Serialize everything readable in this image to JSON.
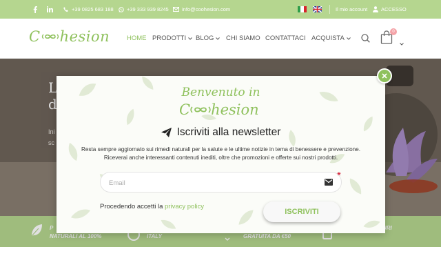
{
  "topbar": {
    "phone": "+39 0825 683 188",
    "whatsapp": "+39 333 939 8245",
    "email": "info@coohesion.com",
    "account": "Il mio account",
    "login": "ACCESSO"
  },
  "logo_text": {
    "start": "C",
    "end": "hesion"
  },
  "nav": {
    "home": "HOME",
    "products": "PRODOTTI",
    "blog": "BLOG",
    "about": "CHI SIAMO",
    "contacts": "CONTATTACI",
    "buy": "ACQUISTA",
    "cart_count": "0"
  },
  "hero": {
    "title_line1": "L",
    "title_line2": "d",
    "sub_line1": "Ini",
    "sub_line2": "sc"
  },
  "features": {
    "f1_line1": "P",
    "f1_line2": "NATURALI AL 100%",
    "f2_line2": "ITALY",
    "f3_line2": "GRATUITA DA €50",
    "f4_line1": "URI"
  },
  "modal": {
    "welcome": "Benvenuto in",
    "logo_start": "C",
    "logo_end": "hesion",
    "newsletter_title": "Iscriviti alla newsletter",
    "desc_line1": "Resta sempre aggiornato sui rimedi naturali per la salute e le ultime notizie in tema di benessere e prevenzione.",
    "desc_line2": "Riceverai anche interessanti contenuti inediti, oltre che promozioni e offerte sui nostri prodotti.",
    "email_placeholder": "Email",
    "email_value": "",
    "required_mark": "*",
    "privacy_prefix": "Procedendo accetti la ",
    "privacy_link": "privacy policy",
    "subscribe": "ISCRIVITI"
  },
  "colors": {
    "accent_green": "#8fc15d",
    "topbar_green": "#b5d68f",
    "required_red": "#d0102b"
  }
}
